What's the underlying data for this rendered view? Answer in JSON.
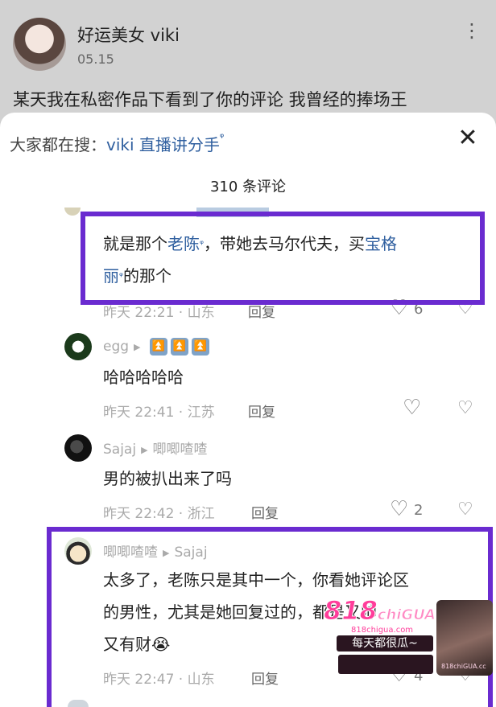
{
  "post": {
    "author": "好运美女 viki",
    "date": "05.15",
    "more_icon": "⋮",
    "text": "某天我在私密作品下看到了你的评论 我曾经的捧场王"
  },
  "sheet": {
    "search_prefix": "大家都在搜：",
    "search_term": "viki 直播讲分手",
    "search_glyph": "ᵠ",
    "close_icon": "✕",
    "comment_count": "310 条评论"
  },
  "comments": [
    {
      "line1_plain_a": "就是那个",
      "line1_link": "老陈",
      "line1_plain_b": "，带她去马尔代夫，买",
      "line1_link2": "宝格",
      "line2_link": "丽",
      "line2_plain": "的那个",
      "footer": "昨天 22:21 · 山东",
      "reply": "回复",
      "likes": "6"
    },
    {
      "user": "egg",
      "badges": [
        "⏫",
        "⏫",
        "⏫"
      ],
      "text": "哈哈哈哈哈",
      "footer": "昨天 22:41 · 江苏",
      "reply": "回复",
      "likes": ""
    },
    {
      "user": "Sajaj",
      "reply_to": "唧唧喳喳",
      "text": "男的被扒出来了吗",
      "footer": "昨天 22:42 · 浙江",
      "reply": "回复",
      "likes": "2"
    },
    {
      "user": "唧唧喳喳",
      "reply_to": "Sajaj",
      "line1": "太多了，老陈只是其中一个，你看她评论区",
      "line2": "的男性，尤其是她回复过的，都是又帅",
      "line3": "又有财",
      "emoji": "😭",
      "footer": "昨天 22:47 · 山东",
      "reply": "回复",
      "likes": "4"
    }
  ],
  "icons": {
    "heart": "♡",
    "broken_heart": "💔",
    "arrow": "▶"
  },
  "ad": {
    "logo_main": "818",
    "logo_sub": "chiGUA",
    "site": "818chigua.com",
    "slogan": "每天都很瓜~",
    "photo_label": "818chiGUA.cc"
  },
  "colors": {
    "highlight_border": "#6a2bd0",
    "link": "#2f5f9f",
    "ad_pink": "#ff3d9a"
  }
}
